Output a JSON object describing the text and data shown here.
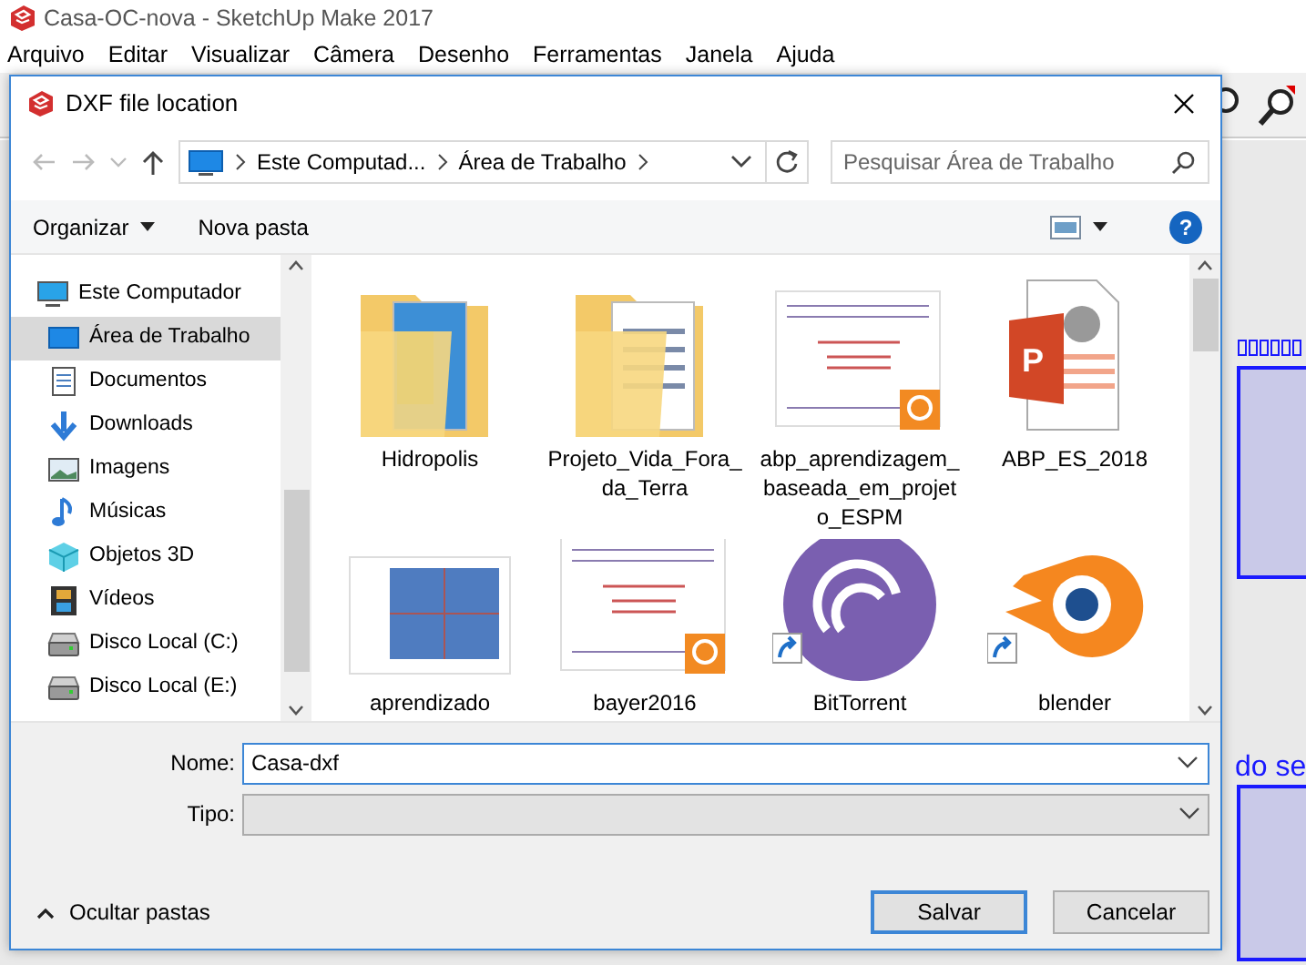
{
  "app": {
    "title": "Casa-OC-nova - SketchUp Make 2017",
    "menu": [
      "Arquivo",
      "Editar",
      "Visualizar",
      "Câmera",
      "Desenho",
      "Ferramentas",
      "Janela",
      "Ajuda"
    ],
    "canvas_text": "do se"
  },
  "dialog": {
    "title": "DXF file location",
    "breadcrumb": [
      "Este Computad...",
      "Área de Trabalho"
    ],
    "search": {
      "placeholder": "Pesquisar Área de Trabalho"
    },
    "toolbar": {
      "organize": "Organizar",
      "new_folder": "Nova pasta",
      "help": "?"
    },
    "nav": [
      {
        "label": "Este Computador",
        "kind": "computer",
        "selected": false,
        "children": [
          {
            "label": "Área de Trabalho",
            "kind": "desktop",
            "selected": true
          },
          {
            "label": "Documentos",
            "kind": "documents",
            "selected": false
          },
          {
            "label": "Downloads",
            "kind": "downloads",
            "selected": false
          },
          {
            "label": "Imagens",
            "kind": "pictures",
            "selected": false
          },
          {
            "label": "Músicas",
            "kind": "music",
            "selected": false
          },
          {
            "label": "Objetos 3D",
            "kind": "objects",
            "selected": false
          },
          {
            "label": "Vídeos",
            "kind": "videos",
            "selected": false
          },
          {
            "label": "Disco Local (C:)",
            "kind": "drive",
            "selected": false
          },
          {
            "label": "Disco Local (E:)",
            "kind": "drive",
            "selected": false
          }
        ]
      }
    ],
    "files": [
      {
        "name": "Hidropolis",
        "kind": "folder"
      },
      {
        "name": "Projeto_Vida_Fora_da_Terra",
        "kind": "folder"
      },
      {
        "name": "abp_aprendizagem_baseada_em_projeto_ESPM",
        "kind": "pdf"
      },
      {
        "name": "ABP_ES_2018",
        "kind": "presentation",
        "icon_letter": "P"
      },
      {
        "name": "aprendizado",
        "kind": "document"
      },
      {
        "name": "bayer2016",
        "kind": "pdf"
      },
      {
        "name": "BitTorrent",
        "kind": "torrent"
      },
      {
        "name": "blender",
        "kind": "blender"
      }
    ],
    "name_field": {
      "label": "Nome:",
      "value": "Casa-dxf"
    },
    "type_field": {
      "label": "Tipo:"
    },
    "hide_folders": "Ocultar pastas",
    "buttons": [
      {
        "label": "Salvar",
        "primary": true
      },
      {
        "label": "Cancelar",
        "primary": false
      }
    ]
  }
}
